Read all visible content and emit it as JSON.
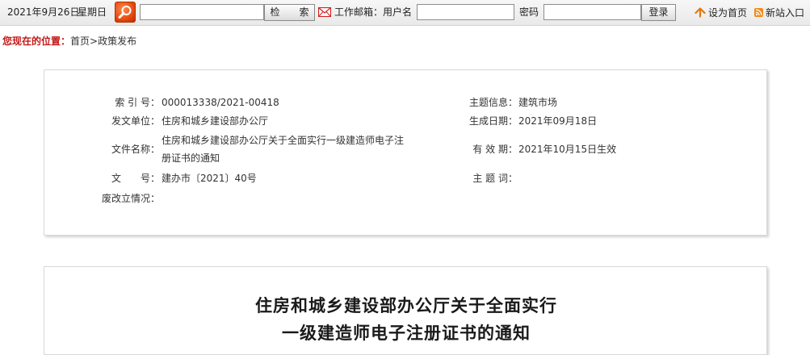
{
  "topbar": {
    "date": "2021年9月26日",
    "weekday": "星期日",
    "search_input_value": "",
    "search_button_label": "检　　索",
    "email_label": "工作邮箱：用户名",
    "username_value": "",
    "password_label": "密码",
    "password_value": "",
    "login_button_label": "登录",
    "set_home_label": "设为首页",
    "rss_label": "新站入口",
    "accent_color": "#e0400a",
    "icons": [
      "search-icon",
      "mail-icon",
      "home-icon",
      "rss-icon"
    ]
  },
  "breadcrumb": {
    "label": "您现在的位置：",
    "home": "首页",
    "separator": ">",
    "current": "政策发布"
  },
  "info": {
    "index_label": "索 引 号：",
    "index_value": "000013338/2021-00418",
    "topic_label": "主题信息：",
    "topic_value": "建筑市场",
    "issuer_label": "发文单位：",
    "issuer_value": "住房和城乡建设部办公厅",
    "created_label": "生成日期：",
    "created_value": "2021年09月18日",
    "filename_label": "文件名称：",
    "filename_value": "住房和城乡建设部办公厅关于全面实行一级建造师电子注册证书的通知",
    "validity_label": "有 效 期：",
    "validity_value": "2021年10月15日生效",
    "docno_label": "文　　号：",
    "docno_value": "建办市〔2021〕40号",
    "keywords_label": "主 题 词：",
    "keywords_value": "",
    "status_label": "废改立情况：",
    "status_value": ""
  },
  "article": {
    "title_line1": "住房和城乡建设部办公厅关于全面实行",
    "title_line2": "一级建造师电子注册证书的通知"
  }
}
